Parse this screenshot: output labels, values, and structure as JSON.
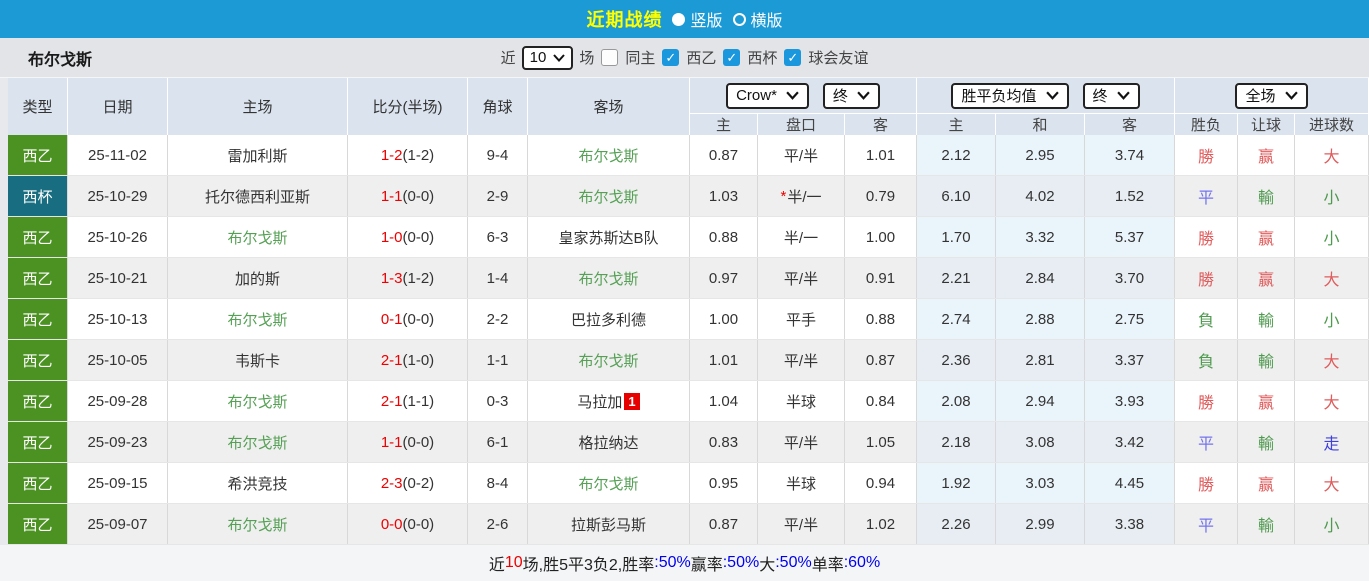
{
  "colors": {
    "topbar_blue": "#1c9ad6",
    "title_yellow": "#ffff00",
    "league_green": "#4b9222",
    "cup_teal": "#186e80",
    "team_highlight_green": "#55a055",
    "score_red": "#ee0000",
    "result_win_red": "#e05c5c",
    "result_lose_green": "#4f9a4f",
    "result_draw_blue": "#7575ee",
    "result_go_blue": "#4040dd",
    "percent_blue": "#0000ee",
    "avg_col_bg": "#eaf4fb"
  },
  "topbar": {
    "title": "近期战绩",
    "options": [
      {
        "label": "竖版",
        "selected": true
      },
      {
        "label": "横版",
        "selected": false
      }
    ]
  },
  "filterbar": {
    "team": "布尔戈斯",
    "near_label": "近",
    "count_value": "10",
    "games_label": "场",
    "same_home": {
      "label": "同主",
      "checked": false
    },
    "competitions": [
      {
        "label": "西乙",
        "checked": true
      },
      {
        "label": "西杯",
        "checked": true
      },
      {
        "label": "球会友谊",
        "checked": true
      }
    ]
  },
  "table": {
    "left_headers": [
      "类型",
      "日期",
      "主场",
      "比分(半场)",
      "角球",
      "客场"
    ],
    "odds_group": {
      "bookmaker": "Crow*",
      "time": "终",
      "cols": [
        "主",
        "盘口",
        "客"
      ]
    },
    "avg_group": {
      "name": "胜平负均值",
      "time": "终",
      "cols": [
        "主",
        "和",
        "客"
      ]
    },
    "result_group": {
      "name": "全场",
      "cols": [
        "胜负",
        "让球",
        "进球数"
      ]
    },
    "rows": [
      {
        "type": "西乙",
        "type_style": "league",
        "date": "25-11-02",
        "home": "雷加利斯",
        "home_hl": false,
        "score": "1-2",
        "half": "(1-2)",
        "corner": "9-4",
        "away": "布尔戈斯",
        "away_hl": true,
        "away_badge": "",
        "odds_home": "0.87",
        "handicap": "平/半",
        "handicap_star": false,
        "odds_away": "1.01",
        "avg_home": "2.12",
        "avg_draw": "2.95",
        "avg_away": "3.74",
        "res": [
          [
            "勝",
            "red"
          ],
          [
            "赢",
            "red"
          ],
          [
            "大",
            "red"
          ]
        ]
      },
      {
        "type": "西杯",
        "type_style": "cup",
        "date": "25-10-29",
        "home": "托尔德西利亚斯",
        "home_hl": false,
        "score": "1-1",
        "half": "(0-0)",
        "corner": "2-9",
        "away": "布尔戈斯",
        "away_hl": true,
        "away_badge": "",
        "odds_home": "1.03",
        "handicap": "半/一",
        "handicap_star": true,
        "odds_away": "0.79",
        "avg_home": "6.10",
        "avg_draw": "4.02",
        "avg_away": "1.52",
        "res": [
          [
            "平",
            "blue"
          ],
          [
            "輸",
            "green"
          ],
          [
            "小",
            "green"
          ]
        ]
      },
      {
        "type": "西乙",
        "type_style": "league",
        "date": "25-10-26",
        "home": "布尔戈斯",
        "home_hl": true,
        "score": "1-0",
        "half": "(0-0)",
        "corner": "6-3",
        "away": "皇家苏斯达B队",
        "away_hl": false,
        "away_badge": "",
        "odds_home": "0.88",
        "handicap": "半/一",
        "handicap_star": false,
        "odds_away": "1.00",
        "avg_home": "1.70",
        "avg_draw": "3.32",
        "avg_away": "5.37",
        "res": [
          [
            "勝",
            "red"
          ],
          [
            "赢",
            "red"
          ],
          [
            "小",
            "green"
          ]
        ]
      },
      {
        "type": "西乙",
        "type_style": "league",
        "date": "25-10-21",
        "home": "加的斯",
        "home_hl": false,
        "score": "1-3",
        "half": "(1-2)",
        "corner": "1-4",
        "away": "布尔戈斯",
        "away_hl": true,
        "away_badge": "",
        "odds_home": "0.97",
        "handicap": "平/半",
        "handicap_star": false,
        "odds_away": "0.91",
        "avg_home": "2.21",
        "avg_draw": "2.84",
        "avg_away": "3.70",
        "res": [
          [
            "勝",
            "red"
          ],
          [
            "赢",
            "red"
          ],
          [
            "大",
            "red"
          ]
        ]
      },
      {
        "type": "西乙",
        "type_style": "league",
        "date": "25-10-13",
        "home": "布尔戈斯",
        "home_hl": true,
        "score": "0-1",
        "half": "(0-0)",
        "corner": "2-2",
        "away": "巴拉多利德",
        "away_hl": false,
        "away_badge": "",
        "odds_home": "1.00",
        "handicap": "平手",
        "handicap_star": false,
        "odds_away": "0.88",
        "avg_home": "2.74",
        "avg_draw": "2.88",
        "avg_away": "2.75",
        "res": [
          [
            "負",
            "green"
          ],
          [
            "輸",
            "green"
          ],
          [
            "小",
            "green"
          ]
        ]
      },
      {
        "type": "西乙",
        "type_style": "league",
        "date": "25-10-05",
        "home": "韦斯卡",
        "home_hl": false,
        "score": "2-1",
        "half": "(1-0)",
        "corner": "1-1",
        "away": "布尔戈斯",
        "away_hl": true,
        "away_badge": "",
        "odds_home": "1.01",
        "handicap": "平/半",
        "handicap_star": false,
        "odds_away": "0.87",
        "avg_home": "2.36",
        "avg_draw": "2.81",
        "avg_away": "3.37",
        "res": [
          [
            "負",
            "green"
          ],
          [
            "輸",
            "green"
          ],
          [
            "大",
            "red"
          ]
        ]
      },
      {
        "type": "西乙",
        "type_style": "league",
        "date": "25-09-28",
        "home": "布尔戈斯",
        "home_hl": true,
        "score": "2-1",
        "half": "(1-1)",
        "corner": "0-3",
        "away": "马拉加",
        "away_hl": false,
        "away_badge": "1",
        "odds_home": "1.04",
        "handicap": "半球",
        "handicap_star": false,
        "odds_away": "0.84",
        "avg_home": "2.08",
        "avg_draw": "2.94",
        "avg_away": "3.93",
        "res": [
          [
            "勝",
            "red"
          ],
          [
            "赢",
            "red"
          ],
          [
            "大",
            "red"
          ]
        ]
      },
      {
        "type": "西乙",
        "type_style": "league",
        "date": "25-09-23",
        "home": "布尔戈斯",
        "home_hl": true,
        "score": "1-1",
        "half": "(0-0)",
        "corner": "6-1",
        "away": "格拉纳达",
        "away_hl": false,
        "away_badge": "",
        "odds_home": "0.83",
        "handicap": "平/半",
        "handicap_star": false,
        "odds_away": "1.05",
        "avg_home": "2.18",
        "avg_draw": "3.08",
        "avg_away": "3.42",
        "res": [
          [
            "平",
            "blue"
          ],
          [
            "輸",
            "green"
          ],
          [
            "走",
            "go"
          ]
        ]
      },
      {
        "type": "西乙",
        "type_style": "league",
        "date": "25-09-15",
        "home": "希洪竞技",
        "home_hl": false,
        "score": "2-3",
        "half": "(0-2)",
        "corner": "8-4",
        "away": "布尔戈斯",
        "away_hl": true,
        "away_badge": "",
        "odds_home": "0.95",
        "handicap": "半球",
        "handicap_star": false,
        "odds_away": "0.94",
        "avg_home": "1.92",
        "avg_draw": "3.03",
        "avg_away": "4.45",
        "res": [
          [
            "勝",
            "red"
          ],
          [
            "赢",
            "red"
          ],
          [
            "大",
            "red"
          ]
        ]
      },
      {
        "type": "西乙",
        "type_style": "league",
        "date": "25-09-07",
        "home": "布尔戈斯",
        "home_hl": true,
        "score": "0-0",
        "half": "(0-0)",
        "corner": "2-6",
        "away": "拉斯彭马斯",
        "away_hl": false,
        "away_badge": "",
        "odds_home": "0.87",
        "handicap": "平/半",
        "handicap_star": false,
        "odds_away": "1.02",
        "avg_home": "2.26",
        "avg_draw": "2.99",
        "avg_away": "3.38",
        "res": [
          [
            "平",
            "blue"
          ],
          [
            "輸",
            "green"
          ],
          [
            "小",
            "green"
          ]
        ]
      }
    ]
  },
  "footer": {
    "parts": [
      [
        "近",
        "dark"
      ],
      [
        "10",
        "red"
      ],
      [
        "场,胜5平3负2, ",
        "dark"
      ],
      [
        "胜率",
        "dark"
      ],
      [
        ":50% ",
        "blue"
      ],
      [
        "赢率",
        "dark"
      ],
      [
        ":50% ",
        "blue"
      ],
      [
        "大",
        "dark"
      ],
      [
        ":50% ",
        "blue"
      ],
      [
        "单率",
        "dark"
      ],
      [
        ":60%",
        "blue"
      ]
    ]
  }
}
